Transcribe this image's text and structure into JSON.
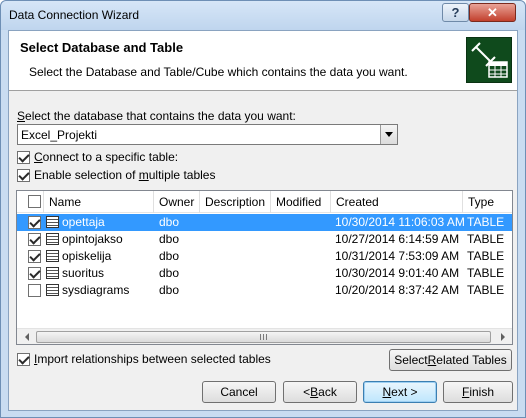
{
  "window": {
    "title": "Data Connection Wizard",
    "help_glyph": "?",
    "close_glyph": "✕"
  },
  "header": {
    "title": "Select Database and Table",
    "subtitle": "Select the Database and Table/Cube which contains the data you want."
  },
  "database": {
    "label_pre": "S",
    "label_rest": "elect the database that contains the data you want:",
    "value": "Excel_Projekti"
  },
  "options": {
    "connect_specific": {
      "pre": "C",
      "rest": "onnect to a specific table:",
      "checked": true
    },
    "enable_multiple": {
      "pre": "Enable selection of ",
      "u": "m",
      "post": "ultiple tables",
      "checked": true
    }
  },
  "table": {
    "columns": [
      "Name",
      "Owner",
      "Description",
      "Modified",
      "Created",
      "Type"
    ],
    "rows": [
      {
        "checked": true,
        "selected": true,
        "name": "opettaja",
        "owner": "dbo",
        "description": "",
        "modified": "",
        "created": "10/30/2014 11:06:03 AM",
        "type": "TABLE"
      },
      {
        "checked": true,
        "selected": false,
        "name": "opintojakso",
        "owner": "dbo",
        "description": "",
        "modified": "",
        "created": "10/27/2014 6:14:59 AM",
        "type": "TABLE"
      },
      {
        "checked": true,
        "selected": false,
        "name": "opiskelija",
        "owner": "dbo",
        "description": "",
        "modified": "",
        "created": "10/31/2014 7:53:09 AM",
        "type": "TABLE"
      },
      {
        "checked": true,
        "selected": false,
        "name": "suoritus",
        "owner": "dbo",
        "description": "",
        "modified": "",
        "created": "10/30/2014 9:01:40 AM",
        "type": "TABLE"
      },
      {
        "checked": false,
        "selected": false,
        "name": "sysdiagrams",
        "owner": "dbo",
        "description": "",
        "modified": "",
        "created": "10/20/2014 8:37:42 AM",
        "type": "TABLE"
      }
    ]
  },
  "import_relationships": {
    "pre": "I",
    "rest": "mport relationships between selected tables",
    "checked": true
  },
  "buttons": {
    "select_related": {
      "pre": "Select ",
      "u": "R",
      "post": "elated Tables"
    },
    "cancel": "Cancel",
    "back": {
      "pre": "< ",
      "u": "B",
      "post": "ack"
    },
    "next": {
      "u": "N",
      "post": "ext >"
    },
    "finish": {
      "u": "F",
      "post": "inish"
    }
  },
  "colors": {
    "selection": "#3399ff",
    "accent_border": "#3c7fb1"
  }
}
